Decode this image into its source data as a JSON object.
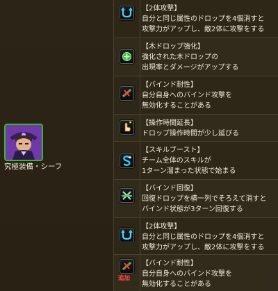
{
  "monster": {
    "name": "究極装備・シーフ",
    "attribute_color": "#36b836"
  },
  "awakenings": [
    {
      "icon": "two-pronged-attack-icon",
      "name": "【2体攻撃】",
      "desc": "自分と同じ属性のドロップを4個消すと\n攻撃力がアップし、敵2体に攻撃をする"
    },
    {
      "icon": "enhanced-wood-orb-icon",
      "name": "【木ドロップ強化】",
      "desc": "強化された木ドロップの\n出現率とダメージがアップする"
    },
    {
      "icon": "bind-resist-icon",
      "name": "【バインド耐性】",
      "desc": "自分自身へのバインド攻撃を\n無効化することがある"
    },
    {
      "icon": "time-extend-icon",
      "name": "【操作時間延長】",
      "desc": "ドロップ操作時間が少し延びる"
    },
    {
      "icon": "skill-boost-icon",
      "name": "【スキルブースト】",
      "desc": "チーム全体のスキルが\n1ターン溜まった状態で始まる"
    },
    {
      "icon": "bind-recovery-icon",
      "name": "【バインド回復】",
      "desc": "回復ドロップを横一列でそろえて消すと\nバインド状態が3ターン回復する"
    },
    {
      "icon": "two-pronged-attack-icon",
      "name": "【2体攻撃】",
      "desc": "自分と同じ属性のドロップを4個消すと\n攻撃力がアップし、敵2体に攻撃をする"
    },
    {
      "icon": "bind-resist-icon",
      "name": "【バインド耐性】",
      "desc": "自分自身へのバインド攻撃を\n無効化することがある",
      "tag": "追加"
    }
  ]
}
